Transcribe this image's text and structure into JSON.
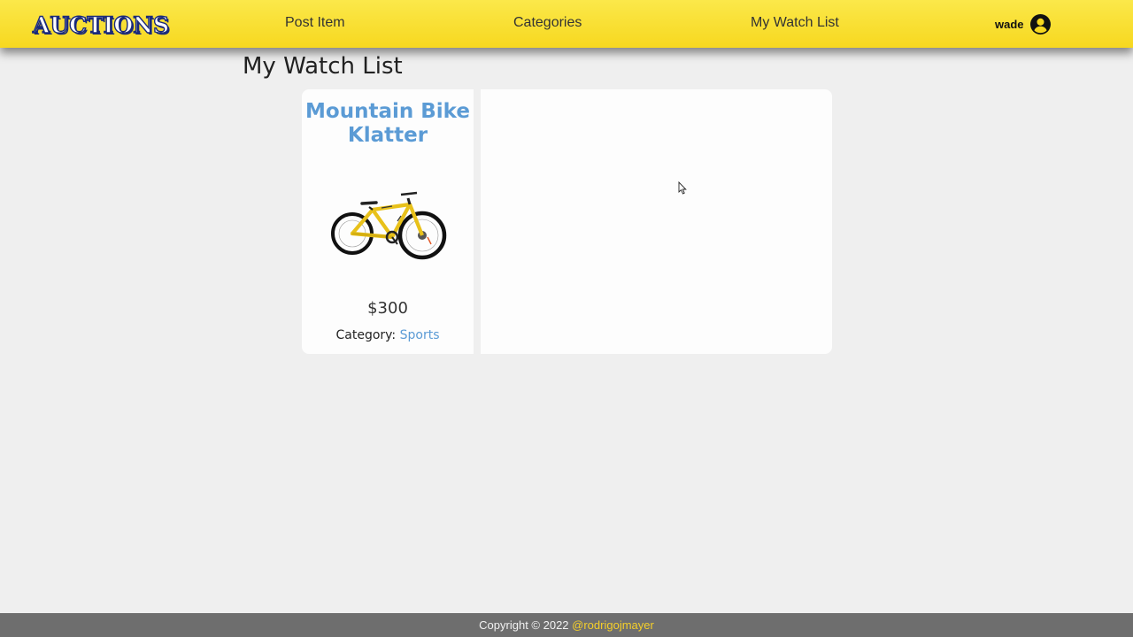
{
  "navbar": {
    "logo_text": "AUCTIONS",
    "links": {
      "post_item": "Post Item",
      "categories": "Categories",
      "watch_list": "My Watch List"
    },
    "user": {
      "name": "wade",
      "icon": "user-circle-icon"
    }
  },
  "main": {
    "title": "My Watch List",
    "items": [
      {
        "title": "Mountain Bike Klatter",
        "image": "bicycle-image",
        "price": "$300",
        "category_label": "Category:",
        "category": "Sports"
      }
    ]
  },
  "footer": {
    "copyright": "Copyright © 2022",
    "author": "@rodrigojmayer"
  },
  "colors": {
    "navbar": "#f7d81f",
    "link": "#5b9bd5",
    "footer_bg": "#6e6e6e",
    "footer_link": "#f5cf2a",
    "logo_outline": "#1b2a7a"
  }
}
